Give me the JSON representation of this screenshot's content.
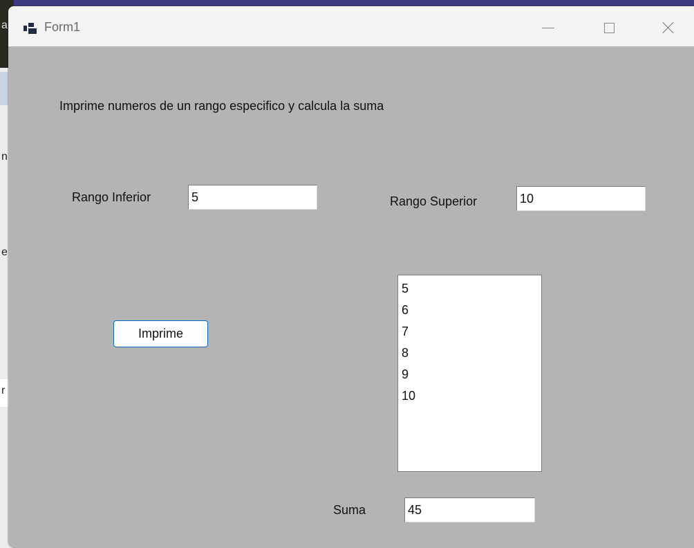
{
  "window": {
    "title": "Form1"
  },
  "form": {
    "description": "Imprime numeros de un rango especifico y calcula la suma",
    "lower_label": "Rango Inferior",
    "lower_value": "5",
    "upper_label": "Rango Superior",
    "upper_value": "10",
    "print_button": "Imprime",
    "list_items": [
      "5",
      "6",
      "7",
      "8",
      "9",
      "10"
    ],
    "sum_label": "Suma",
    "sum_value": "45"
  },
  "background": {
    "partial_chars": [
      "a",
      "n",
      "e",
      "r"
    ]
  }
}
